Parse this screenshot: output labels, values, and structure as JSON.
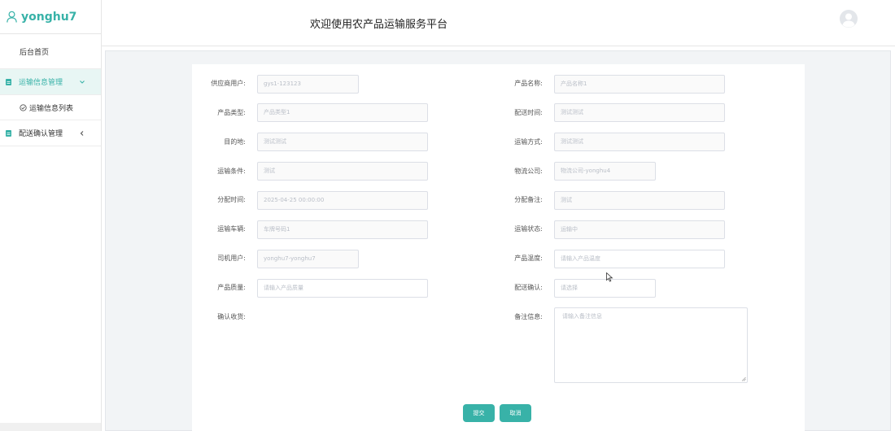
{
  "sidebar": {
    "username": "yonghu7",
    "home": "后台首页",
    "groups": [
      {
        "label": "运输信息管理",
        "sub": "运输信息列表"
      },
      {
        "label": "配送确认管理"
      }
    ]
  },
  "header": {
    "title": "欢迎使用农产品运输服务平台"
  },
  "form": {
    "supplier_user": {
      "label": "供应商用户:",
      "value": "gys1-123123"
    },
    "product_name": {
      "label": "产品名称:",
      "value": "产品名称1"
    },
    "product_type": {
      "label": "产品类型:",
      "value": "产品类型1"
    },
    "delivery_time": {
      "label": "配送时间:",
      "value": "测试测试"
    },
    "destination": {
      "label": "目的地:",
      "value": "测试测试"
    },
    "transport_method": {
      "label": "运输方式:",
      "value": "测试测试"
    },
    "transport_conditions": {
      "label": "运输条件:",
      "value": "测试"
    },
    "logistics_company": {
      "label": "物流公司:",
      "value": "物流公司-yonghu4"
    },
    "assign_time": {
      "label": "分配时间:",
      "value": "2025-04-25 00:00:00"
    },
    "assign_note": {
      "label": "分配备注:",
      "value": "测试"
    },
    "vehicle": {
      "label": "运输车辆:",
      "value": "车牌号码1"
    },
    "transport_status": {
      "label": "运输状态:",
      "value": "运输中"
    },
    "driver_user": {
      "label": "司机用户:",
      "value": "yonghu7-yonghu7"
    },
    "product_temperature": {
      "label": "产品温度:",
      "placeholder": "请输入产品温度"
    },
    "product_quality": {
      "label": "产品质量:",
      "placeholder": "请输入产品质量"
    },
    "delivery_confirm": {
      "label": "配送确认:",
      "placeholder": "请选择"
    },
    "receipt_confirm": {
      "label": "确认收货:"
    },
    "remarks": {
      "label": "备注信息:",
      "placeholder": "请输入备注信息"
    }
  },
  "buttons": {
    "submit": "提交",
    "cancel": "取消"
  },
  "colors": {
    "accent": "#38b2a8",
    "active_bg": "#e8f6f4"
  },
  "icons": [
    "user-icon",
    "doc-icon",
    "chevron-down-icon",
    "chevron-left-icon",
    "check-circle-icon",
    "avatar-icon",
    "cursor-icon"
  ]
}
